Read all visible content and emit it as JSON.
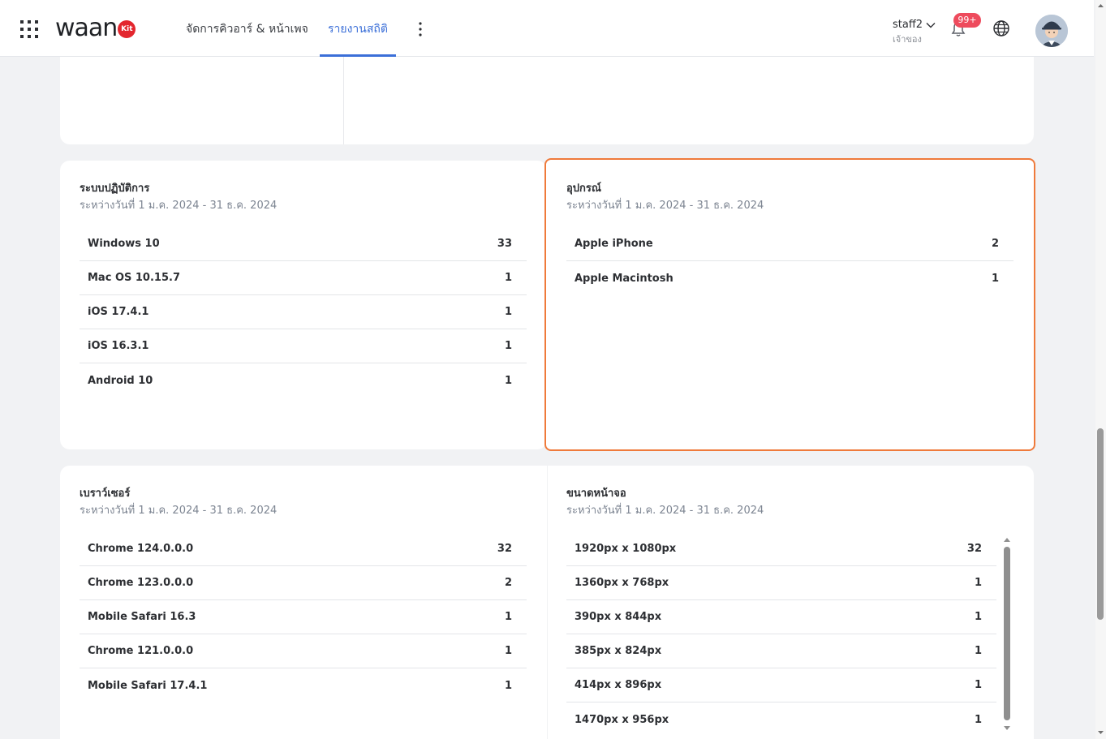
{
  "header": {
    "logo_text": "waan",
    "logo_badge": "Kit",
    "nav": [
      {
        "label": "จัดการคิวอาร์ & หน้าเพจ"
      },
      {
        "label": "รายงานสถิติ"
      }
    ],
    "user": {
      "name": "staff2",
      "role": "เจ้าของ"
    },
    "notification_count": "99+"
  },
  "os_panel": {
    "title": "ระบบปฏิบัติการ",
    "subtitle": "ระหว่างวันที่ 1 ม.ค. 2024 - 31 ธ.ค. 2024",
    "rows": [
      {
        "label": "Windows 10",
        "value": "33"
      },
      {
        "label": "Mac OS 10.15.7",
        "value": "1"
      },
      {
        "label": "iOS 17.4.1",
        "value": "1"
      },
      {
        "label": "iOS 16.3.1",
        "value": "1"
      },
      {
        "label": "Android 10",
        "value": "1"
      }
    ]
  },
  "device_panel": {
    "title": "อุปกรณ์",
    "subtitle": "ระหว่างวันที่ 1 ม.ค. 2024 - 31 ธ.ค. 2024",
    "rows": [
      {
        "label": "Apple iPhone",
        "value": "2"
      },
      {
        "label": "Apple Macintosh",
        "value": "1"
      }
    ]
  },
  "browser_panel": {
    "title": "เบราว์เซอร์",
    "subtitle": "ระหว่างวันที่ 1 ม.ค. 2024 - 31 ธ.ค. 2024",
    "rows": [
      {
        "label": "Chrome 124.0.0.0",
        "value": "32"
      },
      {
        "label": "Chrome 123.0.0.0",
        "value": "2"
      },
      {
        "label": "Mobile Safari 16.3",
        "value": "1"
      },
      {
        "label": "Chrome 121.0.0.0",
        "value": "1"
      },
      {
        "label": "Mobile Safari 17.4.1",
        "value": "1"
      }
    ]
  },
  "screen_panel": {
    "title": "ขนาดหน้าจอ",
    "subtitle": "ระหว่างวันที่ 1 ม.ค. 2024 - 31 ธ.ค. 2024",
    "rows": [
      {
        "label": "1920px x 1080px",
        "value": "32"
      },
      {
        "label": "1360px x 768px",
        "value": "1"
      },
      {
        "label": "390px x 844px",
        "value": "1"
      },
      {
        "label": "385px x 824px",
        "value": "1"
      },
      {
        "label": "414px x 896px",
        "value": "1"
      },
      {
        "label": "1470px x 956px",
        "value": "1"
      }
    ]
  },
  "colors": {
    "accent": "#3b6fd8",
    "highlight": "#ef7a3b",
    "badge": "#ee4b5d",
    "logo_red": "#e3262e"
  },
  "icons": [
    "apps-grid-icon",
    "kebab-menu-icon",
    "chevron-down-icon",
    "bell-icon",
    "globe-icon",
    "avatar"
  ]
}
